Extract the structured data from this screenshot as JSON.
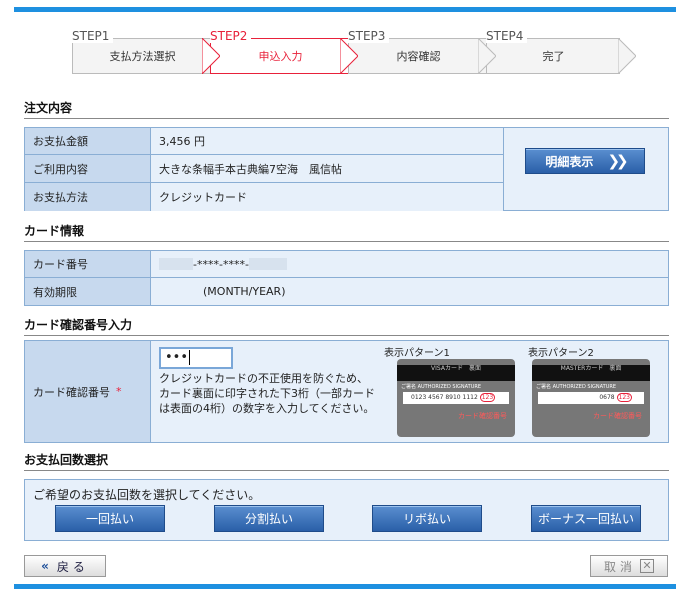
{
  "steps": [
    {
      "step": "STEP1",
      "label": "支払方法選択"
    },
    {
      "step": "STEP2",
      "label": "申込入力"
    },
    {
      "step": "STEP3",
      "label": "内容確認"
    },
    {
      "step": "STEP4",
      "label": "完了"
    }
  ],
  "order": {
    "heading": "注文内容",
    "rows": [
      {
        "label": "お支払金額",
        "value": "3,456 円"
      },
      {
        "label": "ご利用内容",
        "value": "大きな条幅手本古典編7空海　風信帖"
      },
      {
        "label": "お支払方法",
        "value": "クレジットカード"
      }
    ],
    "details_button": "明細表示"
  },
  "card": {
    "heading": "カード情報",
    "number_label": "カード番号",
    "number_value": "-****-****-",
    "expiry_label": "有効期限",
    "expiry_value": "(MONTH/YEAR)"
  },
  "cvv": {
    "heading": "カード確認番号入力",
    "label": "カード確認番号",
    "required_mark": "*",
    "input_value": "•••",
    "help": "クレジットカードの不正使用を防ぐため、カード裏面に印字された下3桁（一部カードは表面の4桁）の数字を入力してください。",
    "pattern1_title": "表示パターン1",
    "pattern2_title": "表示パターン2",
    "pattern1_card": "VISAカード　裏面",
    "pattern2_card": "MASTERカード　裏面",
    "sig_text": "ご署名 AUTHORIZED SIGNATURE",
    "pattern1_number": "0123 4567 8910 1112",
    "pattern1_code": "123",
    "pattern2_number": "0678",
    "pattern2_code": "123",
    "cvv_caption": "カード確認番号"
  },
  "installments": {
    "heading": "お支払回数選択",
    "prompt": "ご希望のお支払回数を選択してください。",
    "options": [
      "一回払い",
      "分割払い",
      "リボ払い",
      "ボーナス一回払い"
    ]
  },
  "nav": {
    "back_icon": "«",
    "back": "戻る",
    "cancel": "取消",
    "cancel_icon": "✕"
  }
}
